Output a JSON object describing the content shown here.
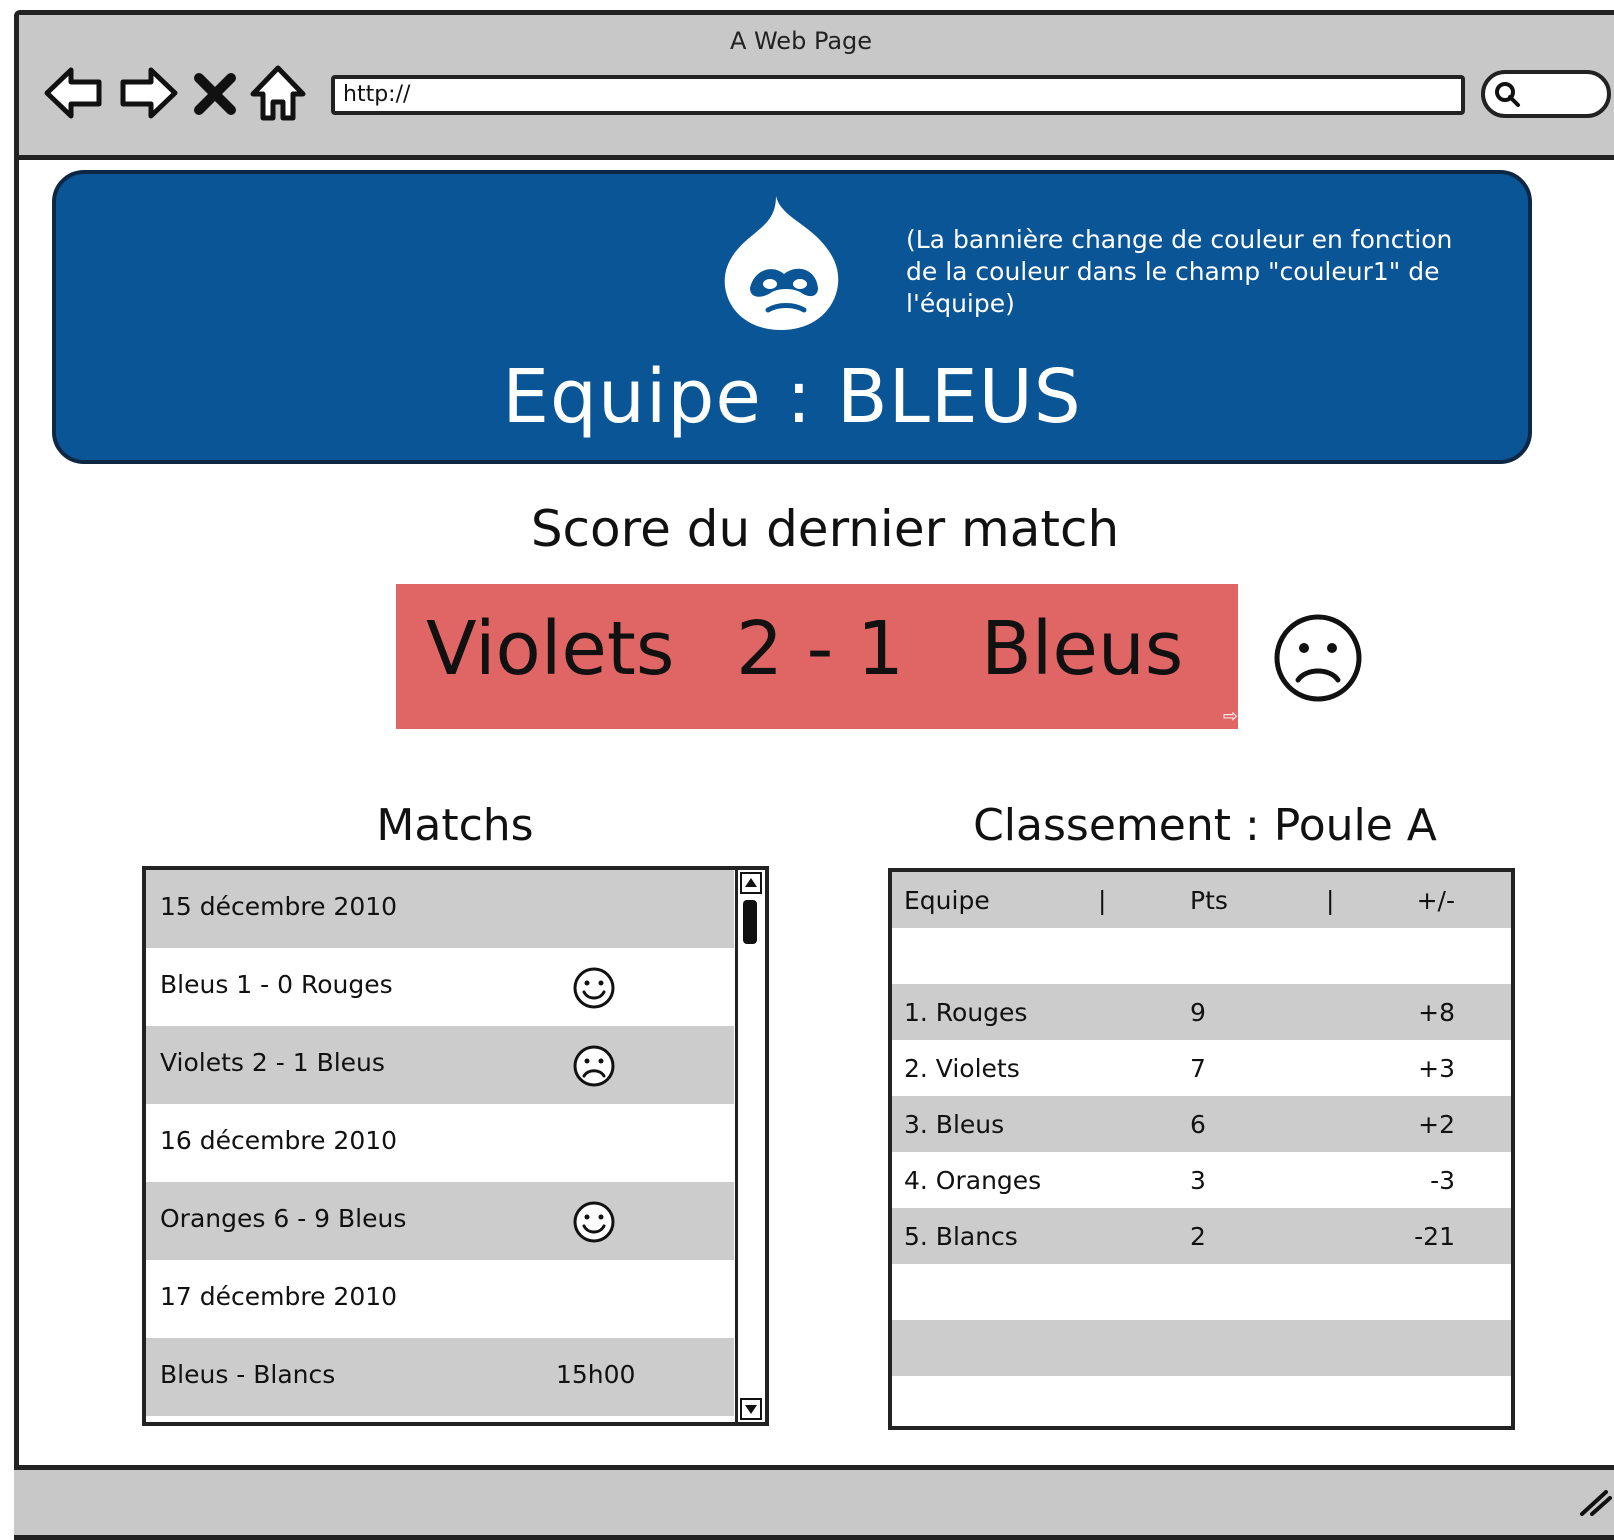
{
  "browser": {
    "title": "A Web Page",
    "url": "http://",
    "nav_icons": [
      "back-arrow-icon",
      "forward-arrow-icon",
      "stop-icon",
      "home-icon"
    ]
  },
  "banner": {
    "note": "(La bannière change de couleur en fonction de la couleur dans le champ \"couleur1\" de l'équipe)",
    "title": "Equipe : BLEUS",
    "logo": "drupal-drop-icon",
    "color": "#0a5596"
  },
  "last_match": {
    "heading": "Score du dernier match",
    "home_team": "Violets",
    "score": "2 - 1",
    "away_team": "Bleus",
    "result_icon": "sad-face-icon",
    "box_color": "#e06666"
  },
  "matches": {
    "heading": "Matchs",
    "rows": [
      {
        "text": "15 décembre 2010",
        "kind": "date"
      },
      {
        "text": "Bleus 1 - 0 Rouges",
        "kind": "match",
        "icon": "happy-face-icon"
      },
      {
        "text": "Violets 2 - 1 Bleus",
        "kind": "match",
        "icon": "sad-face-icon"
      },
      {
        "text": "16 décembre 2010",
        "kind": "date"
      },
      {
        "text": "Oranges 6 - 9 Bleus",
        "kind": "match",
        "icon": "happy-face-icon"
      },
      {
        "text": "17 décembre 2010",
        "kind": "date"
      },
      {
        "text": "Bleus - Blancs",
        "kind": "upcoming",
        "time": "15h00"
      }
    ]
  },
  "ranking": {
    "heading": "Classement : Poule A",
    "columns": [
      "Equipe",
      "|",
      "Pts",
      "|",
      "+/-"
    ],
    "rows": [
      {
        "team": "1. Rouges",
        "pts": "9",
        "diff": "+8"
      },
      {
        "team": "2. Violets",
        "pts": "7",
        "diff": "+3"
      },
      {
        "team": "3. Bleus",
        "pts": "6",
        "diff": "+2"
      },
      {
        "team": "4. Oranges",
        "pts": "3",
        "diff": "-3"
      },
      {
        "team": "5. Blancs",
        "pts": "2",
        "diff": "-21"
      }
    ]
  }
}
